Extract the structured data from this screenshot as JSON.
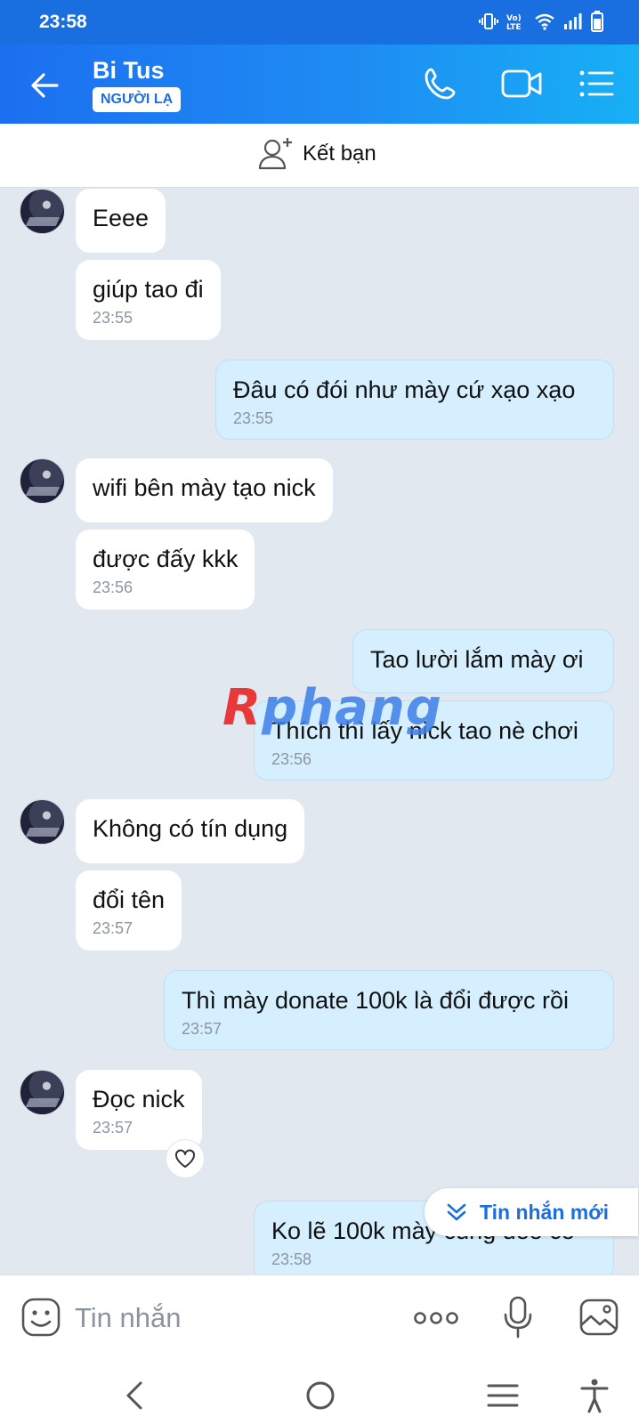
{
  "status_bar": {
    "time": "23:58",
    "icons": [
      "vibrate-icon",
      "volte-icon",
      "wifi-icon",
      "signal-icon",
      "battery-icon"
    ]
  },
  "header": {
    "contact_name": "Bi Tus",
    "badge": "NGƯỜI LẠ",
    "icons": [
      "back-arrow-icon",
      "phone-icon",
      "video-camera-icon",
      "list-menu-icon"
    ]
  },
  "friend_bar": {
    "label": "Kết bạn",
    "icon": "add-person-icon"
  },
  "messages": [
    {
      "dir": "in",
      "text": "Eeee"
    },
    {
      "dir": "in",
      "text": "giúp tao đi",
      "time": "23:55"
    },
    {
      "dir": "out",
      "text": "Đâu có đói như mày cứ xạo xạo",
      "time": "23:55"
    },
    {
      "dir": "in",
      "text": "wifi bên mày tạo nick"
    },
    {
      "dir": "in",
      "text": "được đấy kkk",
      "time": "23:56"
    },
    {
      "dir": "out",
      "text": "Tao lười lắm mày ơi"
    },
    {
      "dir": "out",
      "text": "Thích thì lấy nick tao nè chơi",
      "time": "23:56"
    },
    {
      "dir": "in",
      "text": "Không có tín dụng"
    },
    {
      "dir": "in",
      "text": "đổi tên",
      "time": "23:57"
    },
    {
      "dir": "out",
      "text": "Thì mày donate 100k là đổi được rồi",
      "time": "23:57"
    },
    {
      "dir": "in",
      "text": "Đọc nick",
      "time": "23:57"
    },
    {
      "dir": "out",
      "text": "Ko lẽ 100k mày cũng đéo có",
      "time": "23:58"
    }
  ],
  "watermark": {
    "first": "R",
    "rest": "phang"
  },
  "new_message_pill": {
    "label": "Tin nhắn mới",
    "icon": "double-chevron-down-icon"
  },
  "composer": {
    "placeholder": "Tin nhắn",
    "icons": [
      "emoji-icon",
      "more-dots-icon",
      "microphone-icon",
      "image-icon"
    ]
  },
  "nav_bar": {
    "icons": [
      "nav-back-icon",
      "nav-home-icon",
      "nav-recent-icon",
      "accessibility-icon"
    ]
  },
  "colors": {
    "accent": "#1a6fe0",
    "outgoing_bubble": "#d6efff",
    "chat_bg": "#e2e8ef"
  }
}
